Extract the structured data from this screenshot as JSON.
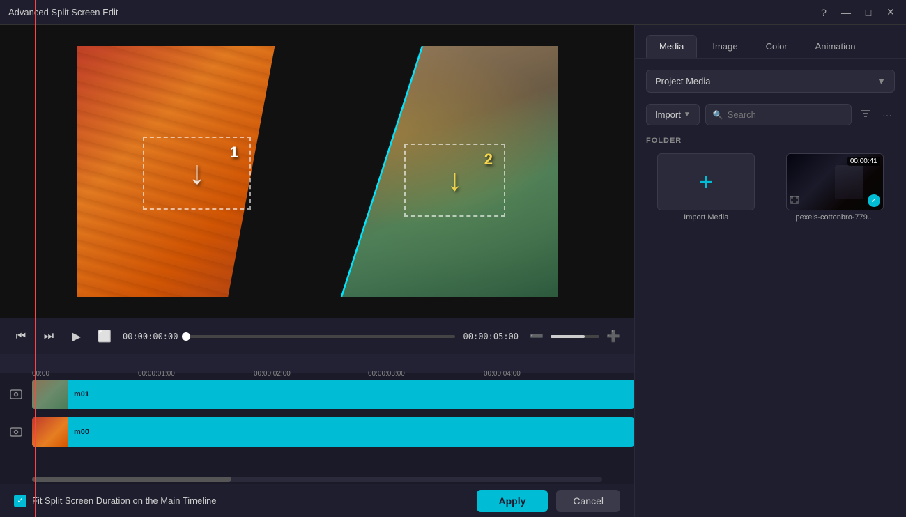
{
  "titlebar": {
    "title": "Advanced Split Screen Edit",
    "help_btn": "?",
    "min_btn": "—",
    "max_btn": "□",
    "close_btn": "✕"
  },
  "preview": {
    "slot1_number": "1",
    "slot2_number": "2"
  },
  "controls": {
    "time_current": "00:00:00:00",
    "time_end": "00:00:05:00"
  },
  "timeline": {
    "ruler_marks": [
      "00:00",
      "00:00:01:00",
      "00:00:02:00",
      "00:00:03:00",
      "00:00:04:00"
    ],
    "track1_label": "m01",
    "track2_label": "m00"
  },
  "right_panel": {
    "tabs": [
      {
        "label": "Media",
        "active": true
      },
      {
        "label": "Image",
        "active": false
      },
      {
        "label": "Color",
        "active": false
      },
      {
        "label": "Animation",
        "active": false
      }
    ],
    "dropdown_value": "Project Media",
    "import_label": "Import",
    "search_placeholder": "Search",
    "folder_label": "FOLDER",
    "media_items": [
      {
        "type": "import",
        "label": "Import Media"
      },
      {
        "type": "video",
        "label": "pexels-cottonbro-779...",
        "duration": "00:00:41",
        "checked": true
      }
    ],
    "filter_icon": "filter",
    "more_icon": "..."
  },
  "bottom_bar": {
    "checkbox_label": "Fit Split Screen Duration on the Main Timeline",
    "apply_label": "Apply",
    "cancel_label": "Cancel"
  }
}
